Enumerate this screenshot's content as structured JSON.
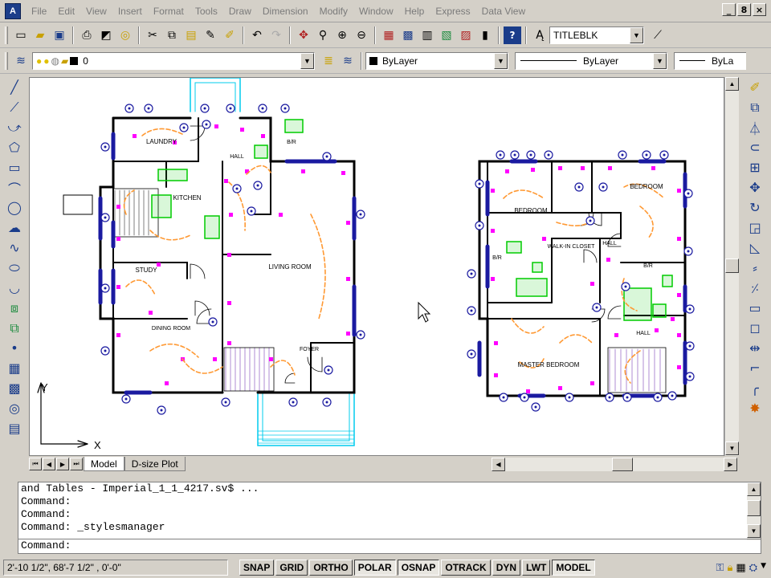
{
  "menubar": {
    "items": [
      "File",
      "Edit",
      "View",
      "Insert",
      "Format",
      "Tools",
      "Draw",
      "Dimension",
      "Modify",
      "Window",
      "Help",
      "Express",
      "Data View"
    ],
    "controls": [
      "_",
      "8",
      "×"
    ]
  },
  "toolbar": {
    "text_style_value": "TITLEBLK"
  },
  "layers": {
    "current_layer": "0",
    "color": "ByLayer",
    "linetype": "ByLayer",
    "lineweight": "ByLa"
  },
  "plan_labels": {
    "laundry": "LAUNDRY",
    "kitchen": "KITCHEN",
    "study": "STUDY",
    "dining": "DINING ROOM",
    "living": "LIVING ROOM",
    "foyer": "FOYER",
    "hall1": "HALL",
    "bath1": "B/R",
    "bedroom1": "BEDROOM",
    "bedroom2": "BEDROOM",
    "walkin": "WALK-IN CLOSET",
    "hall2": "HALL",
    "bath2": "B/R",
    "bath3": "B/R",
    "master": "MASTER BEDROOM",
    "hall3": "HALL"
  },
  "ucs": {
    "x": "X",
    "y": "Y"
  },
  "tabs": [
    {
      "label": "Model"
    },
    {
      "label": "D-size Plot"
    }
  ],
  "command": {
    "lines": [
      "and Tables - Imperial_1_1_4217.sv$ ...",
      "Command:",
      "Command:",
      "Command: _stylesmanager"
    ],
    "prompt": "Command:"
  },
  "status": {
    "coords": "2'-10 1/2\",  68'-7 1/2\" , 0'-0\"",
    "toggles": [
      {
        "label": "SNAP",
        "on": false
      },
      {
        "label": "GRID",
        "on": false
      },
      {
        "label": "ORTHO",
        "on": false
      },
      {
        "label": "POLAR",
        "on": true
      },
      {
        "label": "OSNAP",
        "on": true
      },
      {
        "label": "OTRACK",
        "on": false
      },
      {
        "label": "DYN",
        "on": false
      },
      {
        "label": "LWT",
        "on": false
      },
      {
        "label": "MODEL",
        "on": true
      }
    ]
  },
  "colors": {
    "wall": "#000000",
    "outlet": "#ff00ff",
    "wire": "#ff9933",
    "fixture": "#00cc00",
    "porch": "#00ccee",
    "window": "#1a1aa0"
  }
}
